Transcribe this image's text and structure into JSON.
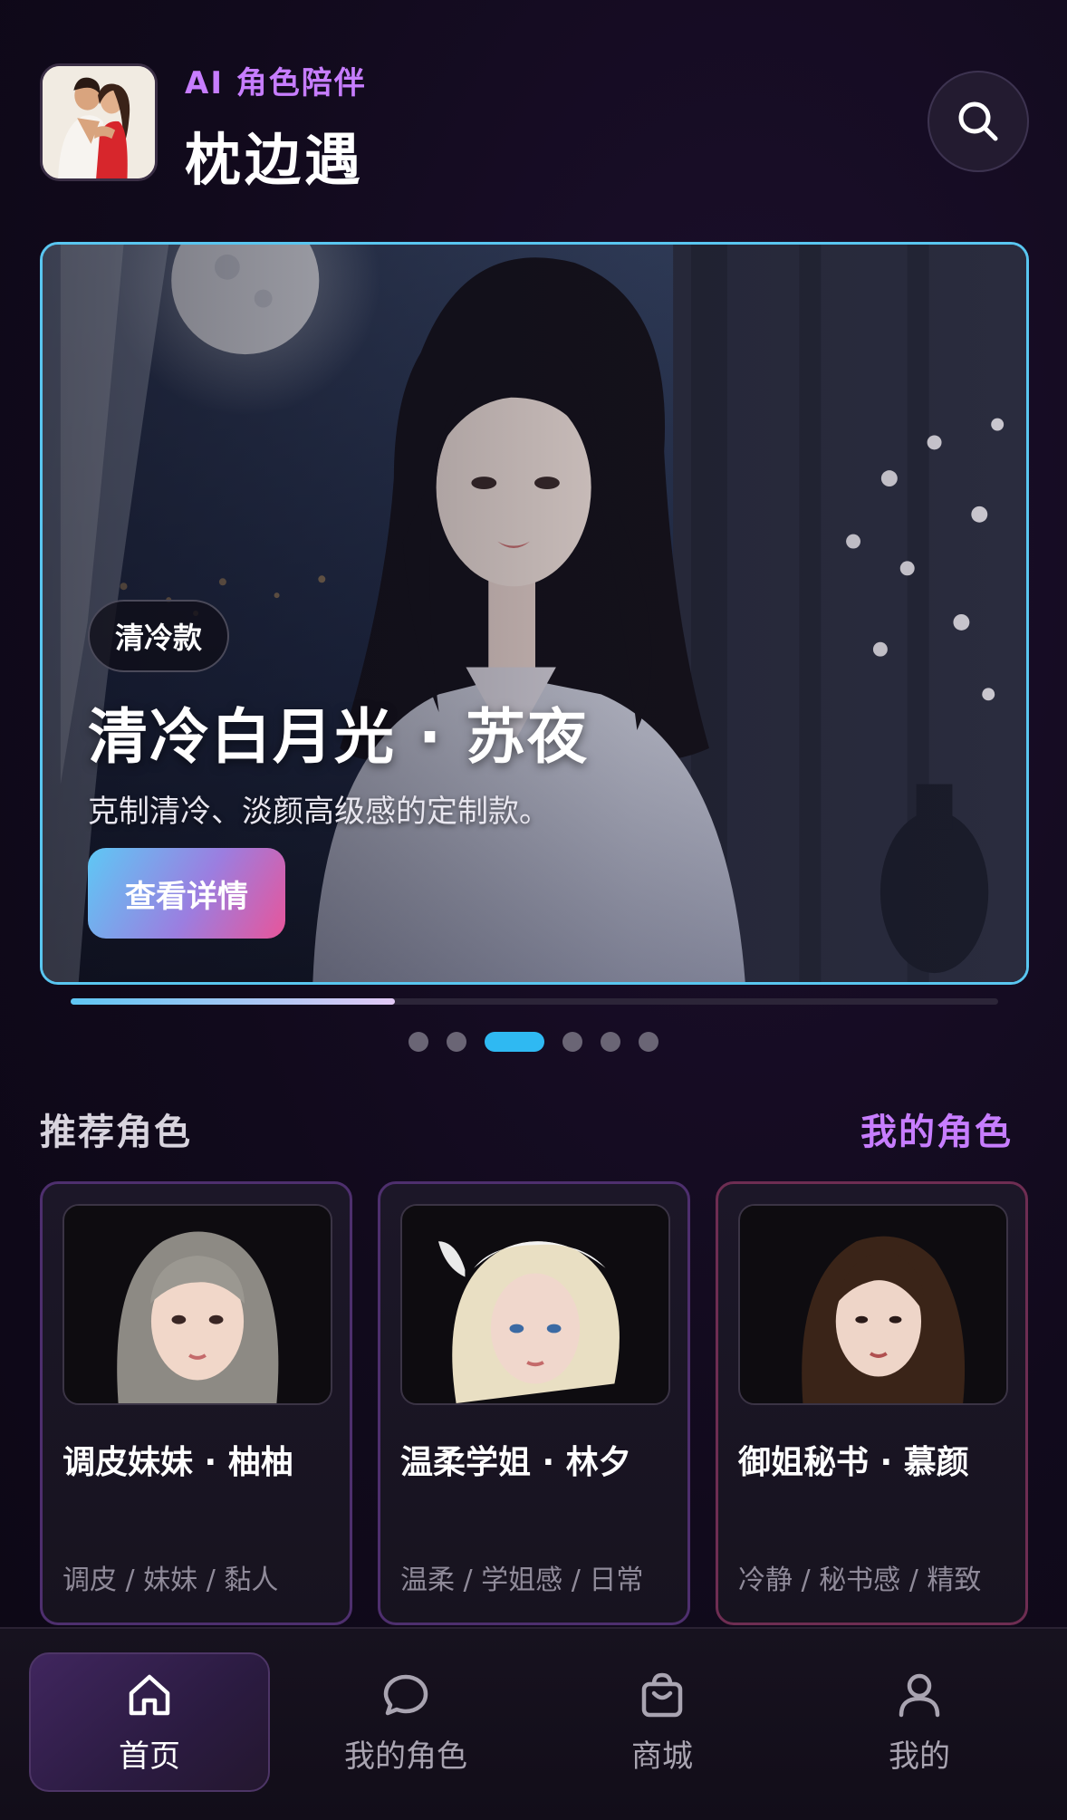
{
  "header": {
    "subtitle": "AI 角色陪伴",
    "title": "枕边遇",
    "logo_icon": "couple-logo",
    "search_icon": "search-icon"
  },
  "banner": {
    "tag": "清冷款",
    "title": "清冷白月光 · 苏夜",
    "description": "克制清冷、淡颜高级感的定制款。",
    "button_label": "查看详情",
    "progress": 0.35,
    "dot_count": 6,
    "active_dot_index": 2
  },
  "section": {
    "title": "推荐角色",
    "link_label": "我的角色"
  },
  "cards": [
    {
      "name": "调皮妹妹 · 柚柚",
      "tags": "调皮 / 妹妹 / 黏人"
    },
    {
      "name": "温柔学姐 · 林夕",
      "tags": "温柔 / 学姐感 / 日常"
    },
    {
      "name": "御姐秘书 · 慕颜",
      "tags": "冷静 / 秘书感 / 精致"
    }
  ],
  "nav": [
    {
      "label": "首页",
      "icon": "home-icon",
      "active": true
    },
    {
      "label": "我的角色",
      "icon": "chat-bubble-icon",
      "active": false
    },
    {
      "label": "商城",
      "icon": "shopping-bag-icon",
      "active": false
    },
    {
      "label": "我的",
      "icon": "user-icon",
      "active": false
    }
  ],
  "colors": {
    "accent_purple": "#c77dff",
    "accent_cyan": "#2fb9f2",
    "banner_border": "#59c6f0",
    "background": "#110a1c"
  }
}
